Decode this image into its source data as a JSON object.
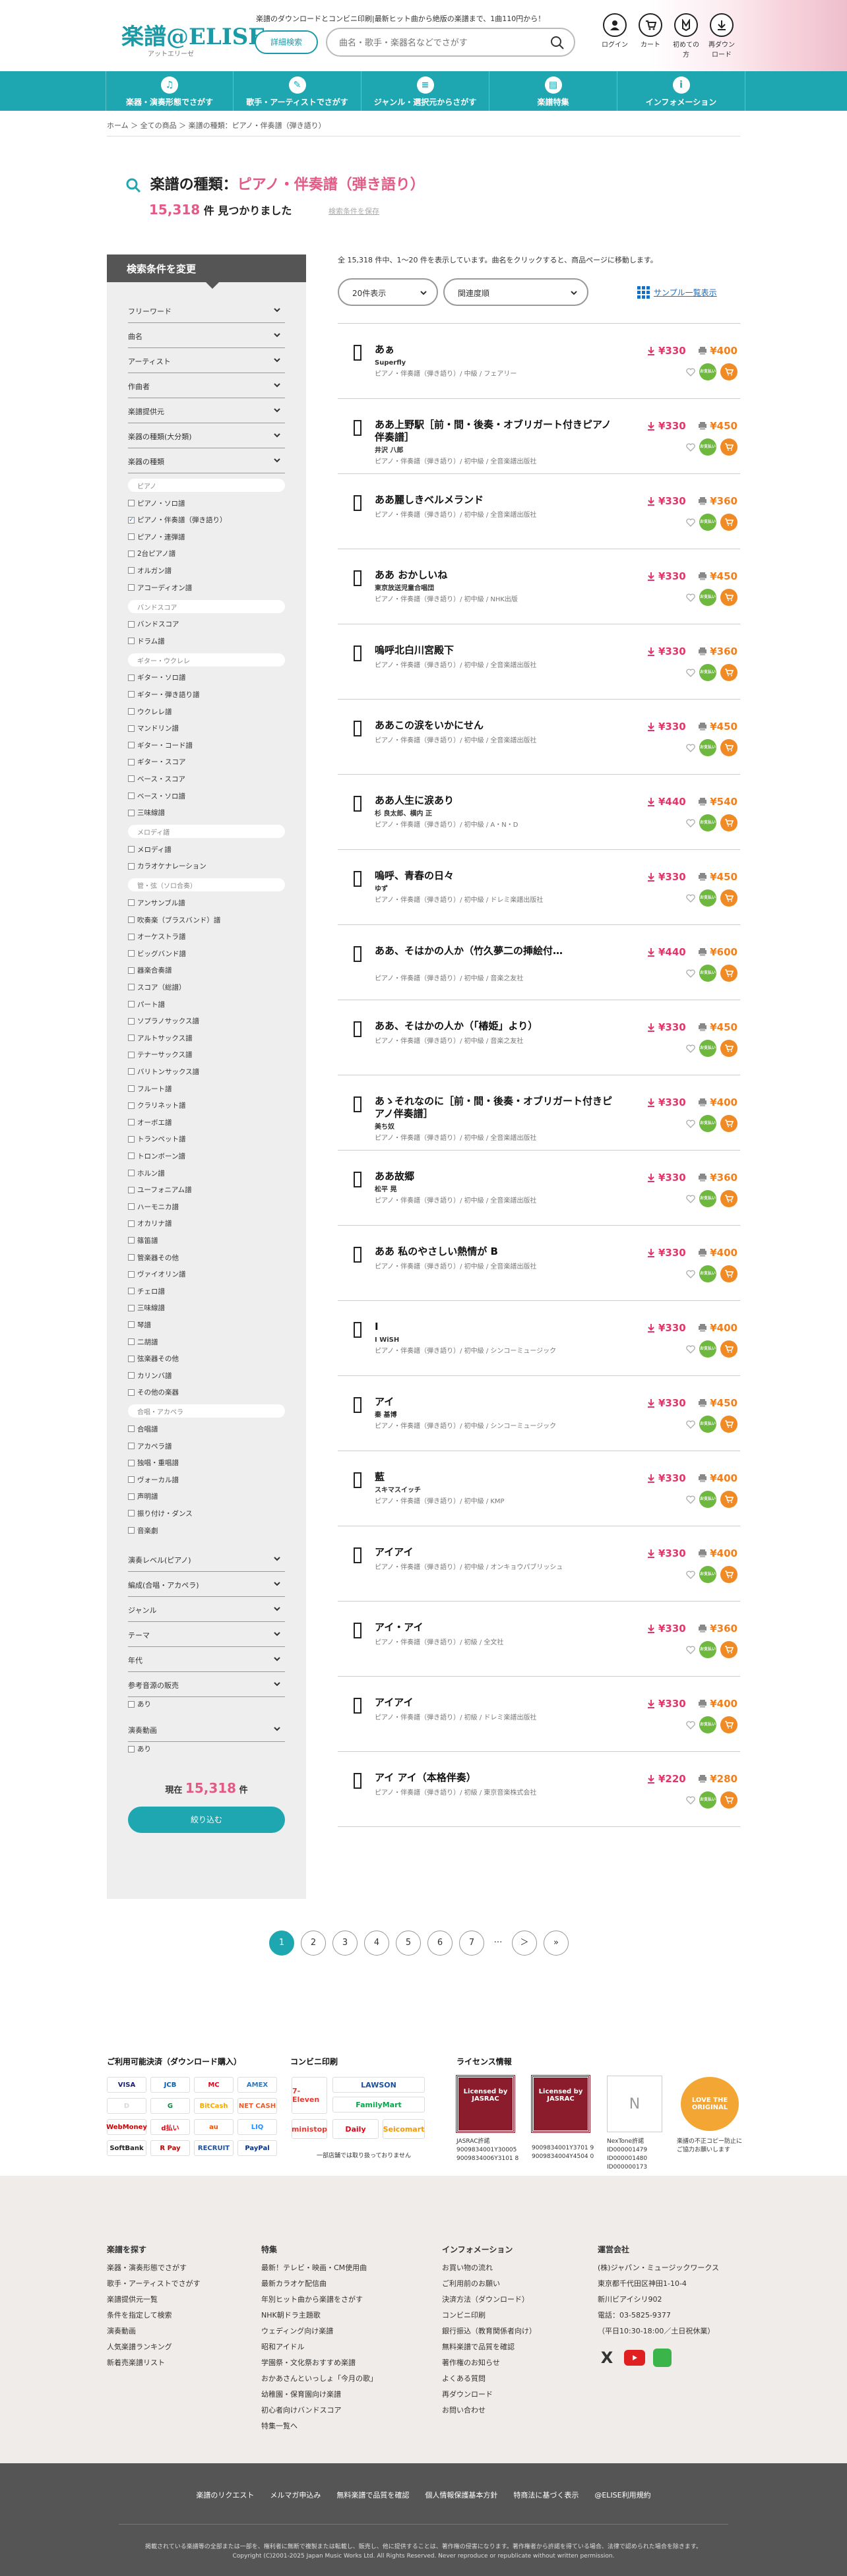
{
  "header": {
    "logo": "楽譜@ELISE",
    "logo_sub": "アットエリーゼ",
    "tagline": "楽譜のダウンロードとコンビニ印刷|最新ヒット曲から絶版の楽譜まで、1曲110円から！",
    "detail_search": "詳細検索",
    "search_placeholder": "曲名・歌手・楽器名などでさがす",
    "icons": [
      {
        "label": "ログイン",
        "icon": "person-icon"
      },
      {
        "label": "カート",
        "icon": "cart-icon"
      },
      {
        "label": "初めての方",
        "icon": "beginner-icon"
      },
      {
        "label": "再ダウンロード",
        "icon": "download-icon"
      }
    ]
  },
  "nav": [
    {
      "label": "楽器・演奏形態でさがす",
      "icon": "instrument-icon"
    },
    {
      "label": "歌手・アーティストでさがす",
      "icon": "mic-icon"
    },
    {
      "label": "ジャンル・選択元からさがす",
      "icon": "genre-icon"
    },
    {
      "label": "楽譜特集",
      "icon": "feature-icon"
    },
    {
      "label": "インフォメーション",
      "icon": "info-icon"
    }
  ],
  "breadcrumb": "ホーム ＞ 全ての商品 ＞ 楽譜の種類：ピアノ・伴奏譜（弾き語り）",
  "title": {
    "prefix": "楽譜の種類：",
    "value": "ピアノ・伴奏譜（弾き語り）"
  },
  "count": {
    "number": "15,318",
    "suffix": "件 見つかりました",
    "save": "検索条件を保存"
  },
  "sidebar": {
    "header": "検索条件を変更",
    "rows_top": [
      "フリーワード",
      "曲名",
      "アーティスト",
      "作曲者",
      "楽譜提供元",
      "楽器の種類(大分類)",
      "楽器の種類"
    ],
    "groups": [
      {
        "name": "ピアノ",
        "items": [
          "ピアノ・ソロ譜",
          "ピアノ・伴奏譜（弾き語り）",
          "ピアノ・連弾譜",
          "2台ピアノ譜",
          "オルガン譜",
          "アコーディオン譜"
        ]
      },
      {
        "name": "バンドスコア",
        "items": [
          "バンドスコア",
          "ドラム譜"
        ]
      },
      {
        "name": "ギター・ウクレレ",
        "items": [
          "ギター・ソロ譜",
          "ギター・弾き語り譜",
          "ウクレレ譜",
          "マンドリン譜",
          "ギター・コード譜",
          "ギター・スコア",
          "ベース・スコア",
          "ベース・ソロ譜",
          "三味線譜"
        ]
      },
      {
        "name": "メロディ譜",
        "items": [
          "メロディ譜",
          "カラオケナレーション"
        ]
      },
      {
        "name": "管・弦（ソロ合奏）",
        "items": [
          "アンサンブル譜",
          "吹奏楽（ブラスバンド）譜",
          "オーケストラ譜",
          "ビッグバンド譜",
          "器楽合奏譜",
          "スコア（総譜）",
          "パート譜",
          "ソプラノサックス譜",
          "アルトサックス譜",
          "テナーサックス譜",
          "バリトンサックス譜",
          "フルート譜",
          "クラリネット譜",
          "オーボエ譜",
          "トランペット譜",
          "トロンボーン譜",
          "ホルン譜",
          "ユーフォニアム譜",
          "ハーモニカ譜",
          "オカリナ譜",
          "篠笛譜",
          "管楽器その他",
          "ヴァイオリン譜",
          "チェロ譜",
          "三味線譜",
          "琴譜",
          "二胡譜",
          "弦楽器その他",
          "カリンバ譜",
          "その他の楽器"
        ]
      },
      {
        "name": "合唱・アカペラ",
        "items": [
          "合唱譜",
          "アカペラ譜",
          "独唱・重唱譜",
          "ヴォーカル譜",
          "声明譜",
          "振り付け・ダンス",
          "音楽劇"
        ]
      }
    ],
    "rows_bottom": [
      "演奏レベル(ピアノ)",
      "編成(合唱・アカペラ)",
      "ジャンル",
      "テーマ",
      "年代",
      "参考音源の販売",
      "演奏動画"
    ],
    "opt_ari": "あり",
    "total_prefix": "現在",
    "total_num": "15,318",
    "total_suffix": "件",
    "narrow_btn": "絞り込む"
  },
  "results": {
    "info": "全 15,318 件中、1〜20 件を表示しています。曲名をクリックすると、商品ページに移動します。",
    "per_page": "20件表示",
    "sort": "関連度順",
    "sample_link": "サンプル一覧表示",
    "items": [
      {
        "name": "あぁ",
        "artist": "Superfly",
        "meta": "ピアノ・伴奏譜（弾き語り）/ 中級 / フェアリー",
        "dl": "¥330",
        "print": "¥400"
      },
      {
        "name": "ああ上野駅［前・間・後奏・オブリガート付きピアノ伴奏譜］",
        "artist": "井沢 八郎",
        "meta": "ピアノ・伴奏譜（弾き語り）/ 初中級 / 全音楽譜出版社",
        "dl": "¥330",
        "print": "¥450"
      },
      {
        "name": "ああ麗しきベルメランド",
        "artist": "",
        "meta": "ピアノ・伴奏譜（弾き語り）/ 初中級 / 全音楽譜出版社",
        "dl": "¥330",
        "print": "¥360"
      },
      {
        "name": "ああ おかしいね",
        "artist": "東京放送児童合唱団",
        "meta": "ピアノ・伴奏譜（弾き語り）/ 初中級 / NHK出版",
        "dl": "¥330",
        "print": "¥450"
      },
      {
        "name": "嗚呼北白川宮殿下",
        "artist": "",
        "meta": "ピアノ・伴奏譜（弾き語り）/ 初中級 / 全音楽譜出版社",
        "dl": "¥330",
        "print": "¥360"
      },
      {
        "name": "ああこの涙をいかにせん",
        "artist": "",
        "meta": "ピアノ・伴奏譜（弾き語り）/ 初中級 / 全音楽譜出版社",
        "dl": "¥330",
        "print": "¥450"
      },
      {
        "name": "ああ人生に涙あり",
        "artist": "杉 良太郎、横内 正",
        "meta": "ピアノ・伴奏譜（弾き語り）/ 初中級 / A・N・D",
        "dl": "¥440",
        "print": "¥540"
      },
      {
        "name": "嗚呼、青春の日々",
        "artist": "ゆず",
        "meta": "ピアノ・伴奏譜（弾き語り）/ 初中級 / ドレミ楽譜出版社",
        "dl": "¥330",
        "print": "¥450"
      },
      {
        "name": "ああ、そはかの人か（竹久夢二の挿絵付…",
        "artist": "",
        "meta": "ピアノ・伴奏譜（弾き語り）/ 初中級 / 音楽之友社",
        "dl": "¥440",
        "print": "¥600"
      },
      {
        "name": "ああ、そはかの人か（「椿姫」より）",
        "artist": "",
        "meta": "ピアノ・伴奏譜（弾き語り）/ 初中級 / 音楽之友社",
        "dl": "¥330",
        "print": "¥450"
      },
      {
        "name": "あゝそれなのに［前・間・後奏・オブリガート付きピアノ伴奏譜］",
        "artist": "美ち奴",
        "meta": "ピアノ・伴奏譜（弾き語り）/ 初中級 / 全音楽譜出版社",
        "dl": "¥330",
        "print": "¥400"
      },
      {
        "name": "ああ故郷",
        "artist": "松平 晃",
        "meta": "ピアノ・伴奏譜（弾き語り）/ 初中級 / 全音楽譜出版社",
        "dl": "¥330",
        "print": "¥360"
      },
      {
        "name": "ああ 私のやさしい熱情が B",
        "artist": "",
        "meta": "ピアノ・伴奏譜（弾き語り）/ 初中級 / 全音楽譜出版社",
        "dl": "¥330",
        "print": "¥400"
      },
      {
        "name": "I",
        "artist": "I WiSH",
        "meta": "ピアノ・伴奏譜（弾き語り）/ 初中級 / シンコーミュージック",
        "dl": "¥330",
        "print": "¥400"
      },
      {
        "name": "アイ",
        "artist": "秦 基博",
        "meta": "ピアノ・伴奏譜（弾き語り）/ 初中級 / シンコーミュージック",
        "dl": "¥330",
        "print": "¥450"
      },
      {
        "name": "藍",
        "artist": "スキマスイッチ",
        "meta": "ピアノ・伴奏譜（弾き語り）/ 初中級 / KMP",
        "dl": "¥330",
        "print": "¥400"
      },
      {
        "name": "アイアイ",
        "artist": "",
        "meta": "ピアノ・伴奏譜（弾き語り）/ 初中級 / オンキョウパブリッシュ",
        "dl": "¥330",
        "print": "¥400"
      },
      {
        "name": "アイ・アイ",
        "artist": "",
        "meta": "ピアノ・伴奏譜（弾き語り）/ 初級 / 全文社",
        "dl": "¥330",
        "print": "¥360"
      },
      {
        "name": "アイアイ",
        "artist": "",
        "meta": "ピアノ・伴奏譜（弾き語り）/ 初級 / ドレミ楽譜出版社",
        "dl": "¥330",
        "print": "¥400"
      },
      {
        "name": "アイ アイ（本格伴奏）",
        "artist": "",
        "meta": "ピアノ・伴奏譜（弾き語り）/ 初級 / 東京音楽株式会社",
        "dl": "¥220",
        "print": "¥280"
      }
    ],
    "pay_badge": "お支払い"
  },
  "pager": [
    "1",
    "2",
    "3",
    "4",
    "5",
    "6",
    "7",
    "…",
    "＞",
    "»"
  ],
  "payment": {
    "h1": "ご利用可能決済（ダウンロード購入）",
    "h2": "コンビニ印刷",
    "h3": "ライセンス情報",
    "logos1": [
      "VISA",
      "JCB",
      "MC",
      "AMEX",
      "D",
      "G",
      "BitCash",
      "NET CASH",
      "WebMoney",
      "d払い",
      "au",
      "LIQ",
      "SoftBank",
      "R Pay",
      "RECRUIT",
      "PayPal"
    ],
    "logos2": [
      "7-Eleven",
      "LAWSON",
      "FamilyMart",
      "ministop",
      "Daily",
      "Seicomart"
    ],
    "conv_note": "一部店舗では取り扱っておりません",
    "jasrac1": "Licensed by JASRAC",
    "jasrac2": "Licensed by JASRAC",
    "jasrac_text1": "JASRAC許諾 9009834001Y30005 9009834006Y3101 8",
    "jasrac_text2": "9009834001Y3701 9 9009834004Y4504 0",
    "nextone": "NexTone許諾 ID000001479 ID000001480 ID000000173",
    "love": "LOVE THE ORIGINAL",
    "love_note": "楽譜の不正コピー防止にご協力お願いします"
  },
  "footer": {
    "col1": {
      "title": "楽譜を探す",
      "items": [
        "楽器・演奏形態でさがす",
        "歌手・アーティストでさがす",
        "楽譜提供元一覧",
        "条件を指定して検索",
        "演奏動画",
        "人気楽譜ランキング",
        "新着売楽譜リスト"
      ]
    },
    "col2": {
      "title": "特集",
      "items": [
        "最新！テレビ・映画・CM使用曲",
        "最新カラオケ配信曲",
        "年別ヒット曲から楽譜をさがす",
        "NHK朝ドラ主題歌",
        "ウェディング向け楽譜",
        "昭和アイドル",
        "学園祭・文化祭おすすめ楽譜",
        "おかあさんといっしょ「今月の歌」",
        "幼稚園・保育園向け楽譜",
        "初心者向けバンドスコア",
        "特集一覧へ"
      ]
    },
    "col3": {
      "title": "インフォメーション",
      "items": [
        "お買い物の流れ",
        "ご利用前のお願い",
        "決済方法（ダウンロード）",
        "コンビニ印刷",
        "銀行振込（教育関係者向け）",
        "無料楽譜で品質を確認",
        "著作権のお知らせ",
        "よくある質問",
        "再ダウンロード",
        "お問い合わせ"
      ]
    },
    "col4": {
      "title": "運営会社",
      "items": [
        "(株)ジャパン・ミュージックワークス",
        "東京都千代田区神田1-10-4",
        "新川ビアイシリ902",
        "電話：03-5825-9377",
        "（平日10:30-18:00／土日祝休業）"
      ]
    },
    "links": [
      "楽譜のリクエスト",
      "メルマガ申込み",
      "無料楽譜で品質を確認",
      "個人情報保護基本方針",
      "特商法に基づく表示",
      "@ELISE利用規約"
    ],
    "copy1": "掲載されている楽譜等の全部または一部を、権利者に無断で複製または転載し、販売し、他に提供することは、著作権の侵害になります。著作権者から許諾を得ている場合、法律で認められた場合を除きます。",
    "copy2": "Copyright (C)2001-2025 Japan Music Works Ltd. All Rights Reserved. Never reproduce or republicate without written permission."
  },
  "colors": {
    "teal": "#1fa7b1",
    "pink": "#e25a86",
    "dl_price": "#e2366a",
    "print_price": "#f07f1f"
  }
}
